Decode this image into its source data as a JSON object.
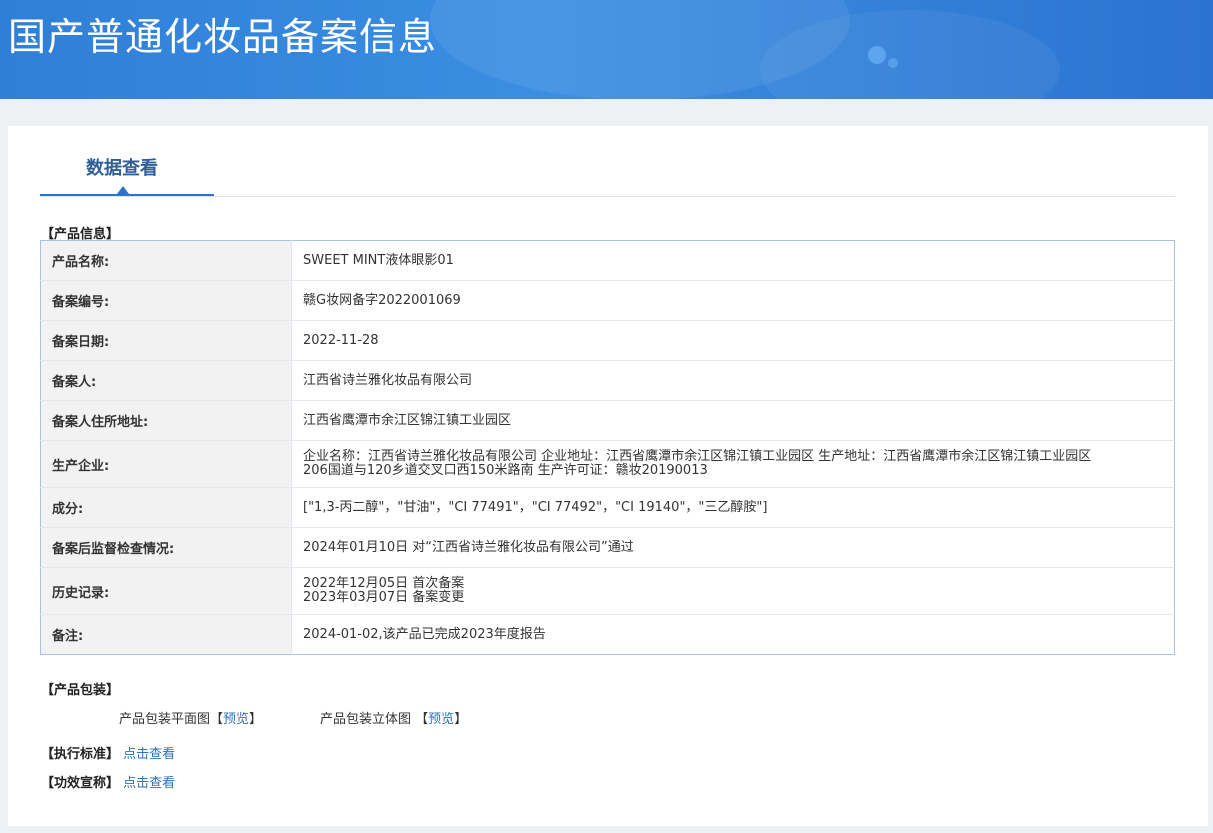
{
  "header": {
    "title": "国产普通化妆品备案信息"
  },
  "tabs": {
    "active": "数据查看"
  },
  "product_info": {
    "section_title": "【产品信息】",
    "rows": [
      {
        "key": "产品名称:",
        "value": "SWEET MINT液体眼影01"
      },
      {
        "key": "备案编号:",
        "value": "赣G妆网备字2022001069"
      },
      {
        "key": "备案日期:",
        "value": "2022-11-28"
      },
      {
        "key": "备案人:",
        "value": "江西省诗兰雅化妆品有限公司"
      },
      {
        "key": "备案人住所地址:",
        "value": "江西省鹰潭市余江区锦江镇工业园区"
      },
      {
        "key": "生产企业:",
        "value_line1": "企业名称：江西省诗兰雅化妆品有限公司 企业地址：江西省鹰潭市余江区锦江镇工业园区 生产地址：江西省鹰潭市余江区锦江镇工业园区",
        "value_line2": "206国道与120乡道交叉口西150米路南 生产许可证：赣妆20190013"
      },
      {
        "key": "成分:",
        "value": "[\"1,3-丙二醇\"，\"甘油\"，\"CI 77491\"，\"CI 77492\"，\"CI 19140\"，\"三乙醇胺\"]"
      },
      {
        "key": "备案后监督检查情况:",
        "value": "2024年01月10日 对“江西省诗兰雅化妆品有限公司”通过"
      },
      {
        "key": "历史记录:",
        "value_line1": "2022年12月05日 首次备案",
        "value_line2": "2023年03月07日 备案变更"
      },
      {
        "key": "备注:",
        "value": "2024-01-02,该产品已完成2023年度报告"
      }
    ]
  },
  "packaging": {
    "section_title": "【产品包装】",
    "flat_label": "产品包装平面图",
    "flat_link": "预览",
    "stereo_label": "产品包装立体图",
    "stereo_link": "预览",
    "bracket_open": "【",
    "bracket_close": "】"
  },
  "standards": {
    "label": "【执行标准】",
    "link": "点击查看"
  },
  "efficacy": {
    "label": "【功效宣称】",
    "link": "点击查看"
  }
}
